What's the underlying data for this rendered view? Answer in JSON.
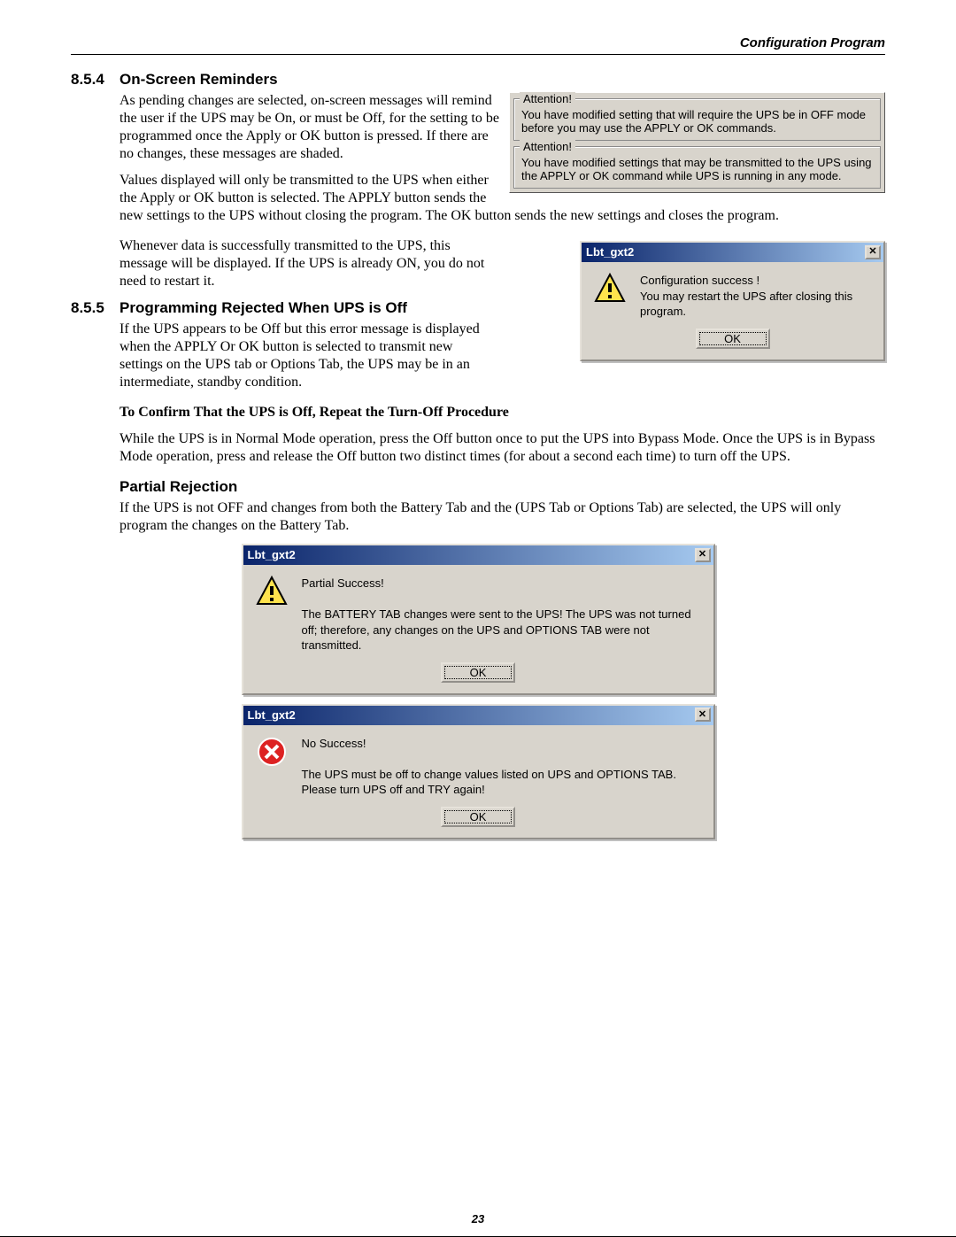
{
  "header": {
    "section": "Configuration Program"
  },
  "page_number": "23",
  "s854": {
    "num": "8.5.4",
    "title": "On-Screen Reminders",
    "p1": "As pending changes are selected, on-screen messages will remind the user if the UPS may be On, or must be Off, for the setting to be programmed once the Apply or OK button is pressed. If there are no changes, these messages are shaded.",
    "p2": "Values displayed will only be transmitted to the UPS when either the Apply or OK button is selected. The APPLY button sends the new settings to the UPS without closing the program. The OK button sends the new settings and closes the program.",
    "p3": "Whenever data is successfully transmitted to the UPS, this message will be displayed. If the UPS is already ON, you do not need to restart it."
  },
  "attention_box": {
    "legend": "Attention!",
    "msg1": "You have modified setting that will require the UPS be in OFF mode before you may use the APPLY or OK commands.",
    "msg2": "You have modified settings that may be transmitted to the UPS using the APPLY or OK command while UPS is running in any mode."
  },
  "success_dialog": {
    "title": "Lbt_gxt2",
    "line1": "Configuration success !",
    "line2": "You may restart the UPS after closing this program.",
    "ok": "OK"
  },
  "s855": {
    "num": "8.5.5",
    "title": "Programming Rejected When UPS is Off",
    "p1": "If the UPS appears to be Off but this error message is displayed when the APPLY Or OK button is selected to transmit new settings on the UPS tab or Options Tab, the UPS may be in an intermediate, standby condition.",
    "confirm_head": "To Confirm That the UPS is Off, Repeat the Turn-Off Procedure",
    "confirm_body": "While the UPS is in Normal Mode operation, press the Off button once to put the UPS into Bypass Mode. Once the UPS is in Bypass Mode operation, press and release the Off button two distinct times (for about a second each time) to turn off the UPS."
  },
  "partial": {
    "head": "Partial Rejection",
    "body": "If the UPS is not OFF and changes from both the Battery Tab and the (UPS Tab or Options Tab) are selected, the UPS will only program the changes on the Battery Tab."
  },
  "partial_dialog": {
    "title": "Lbt_gxt2",
    "line1": "Partial Success!",
    "line2": "The BATTERY TAB changes were sent to the UPS! The UPS was not turned off; therefore, any changes on the UPS and OPTIONS TAB were not transmitted.",
    "ok": "OK"
  },
  "fail_dialog": {
    "title": "Lbt_gxt2",
    "line1": "No Success!",
    "line2": "The UPS must be off to change values listed on UPS and OPTIONS TAB. Please turn UPS off and TRY again!",
    "ok": "OK"
  },
  "close_glyph": "✕"
}
